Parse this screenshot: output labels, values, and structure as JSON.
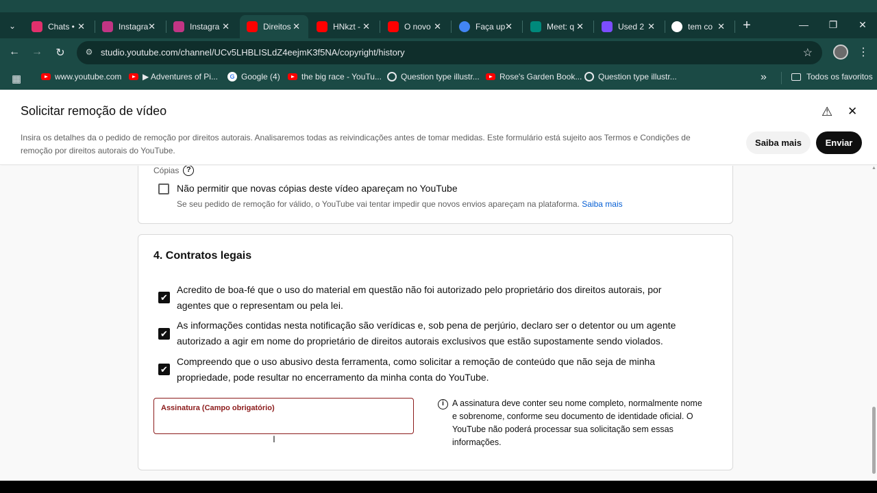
{
  "browser": {
    "tabs": [
      {
        "title": "Chats •",
        "favicon_color": "#e1306c"
      },
      {
        "title": "Instagram",
        "favicon_color": "#c13584"
      },
      {
        "title": "Instagram",
        "favicon_color": "#c13584"
      },
      {
        "title": "Direitos",
        "favicon_color": "#ff0000",
        "active": true
      },
      {
        "title": "HNkzt -",
        "favicon_color": "#ff0000"
      },
      {
        "title": "O novo",
        "favicon_color": "#ff0000"
      },
      {
        "title": "Faça up",
        "favicon_color": "#4285f4"
      },
      {
        "title": "Meet: q",
        "favicon_color": "#00897b"
      },
      {
        "title": "Used 2",
        "favicon_color": "#7c4dff"
      },
      {
        "title": "tem co",
        "favicon_color": "#ffffff"
      }
    ],
    "url": "studio.youtube.com/channel/UCv5LHBLISLdZ4eejmK3f5NA/copyright/history",
    "bookmarks": [
      {
        "label": "www.youtube.com",
        "icon": "youtube"
      },
      {
        "label": "▶ Adventures of Pi...",
        "icon": "youtube"
      },
      {
        "label": "Google (4)",
        "icon": "google"
      },
      {
        "label": "the big race - YouTu...",
        "icon": "youtube"
      },
      {
        "label": "Question type illustr...",
        "icon": "globe"
      },
      {
        "label": "Rose's Garden Book...",
        "icon": "youtube"
      },
      {
        "label": "Question type illustr...",
        "icon": "globe"
      }
    ],
    "all_bookmarks_label": "Todos os favoritos"
  },
  "header": {
    "title": "Solicitar remoção de vídeo",
    "description": "Insira os detalhes da o pedido de remoção por direitos autorais. Analisaremos todas as reivindicações antes de tomar medidas. Este formulário está sujeito aos Termos e Condições de remoção por direitos autorais do YouTube.",
    "learn_more_label": "Saiba mais",
    "submit_label": "Enviar"
  },
  "copies_section": {
    "label": "Cópias",
    "checkbox_label": "Não permitir que novas cópias deste vídeo apareçam no YouTube",
    "checkbox_checked": false,
    "helper": "Se seu pedido de remoção for válido, o YouTube vai tentar impedir que novos envios apareçam na plataforma.",
    "helper_link": "Saiba mais"
  },
  "legal_section": {
    "title": "4. Contratos legais",
    "agreements": [
      {
        "text": "Acredito de boa-fé que o uso do material em questão não foi autorizado pelo proprietário dos direitos autorais, por agentes que o representam ou pela lei.",
        "checked": true
      },
      {
        "text": "As informações contidas nesta notificação são verídicas e, sob pena de perjúrio, declaro ser o detentor ou um agente autorizado a agir em nome do proprietário de direitos autorais exclusivos que estão supostamente sendo violados.",
        "checked": true
      },
      {
        "text": "Compreendo que o uso abusivo desta ferramenta, como solicitar a remoção de conteúdo que não seja de minha propriedade, pode resultar no encerramento da minha conta do YouTube.",
        "checked": true
      }
    ],
    "signature_label": "Assinatura (Campo obrigatório)",
    "signature_value": "",
    "signature_info": "A assinatura deve conter seu nome completo, normalmente nome e sobrenome, conforme seu documento de identidade oficial. O YouTube não poderá processar sua solicitação sem essas informações."
  }
}
